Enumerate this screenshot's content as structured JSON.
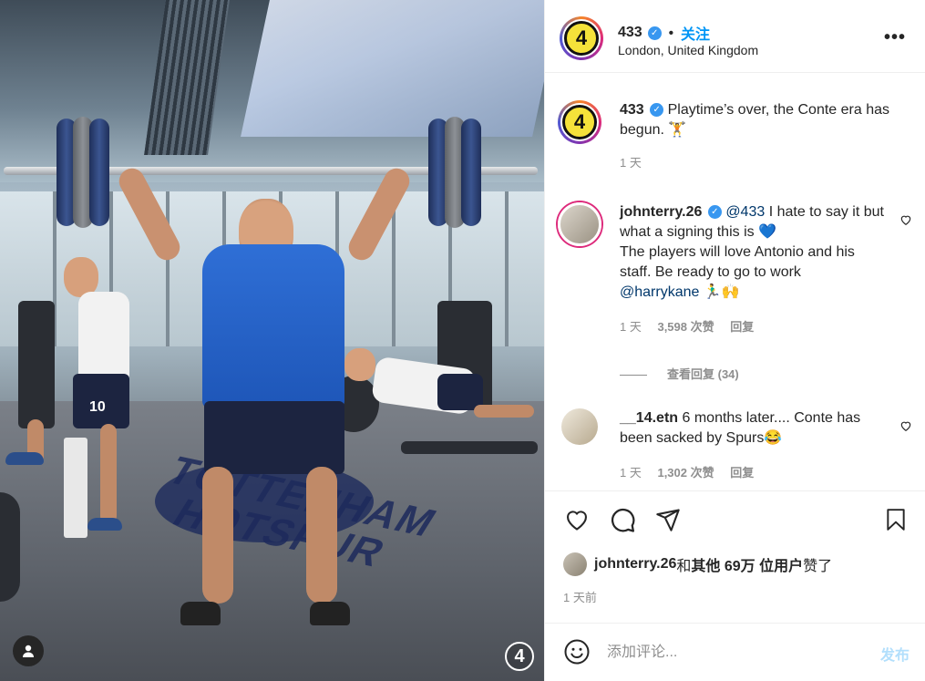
{
  "header": {
    "username": "433",
    "follow_label": "关注",
    "location": "London, United Kingdom",
    "more_icon": "more-horizontal-icon"
  },
  "caption": {
    "username": "433",
    "text": "Playtime’s over, the Conte era has begun. 🏋",
    "time": "1 天"
  },
  "comments": [
    {
      "username": "johnterry.26",
      "mention": "@433",
      "text_line1": " I hate to say it but what a signing this is 💙",
      "text_line2": "The players will love Antonio and his staff. Be ready to go to work",
      "mention2": "@harrykane",
      "emoji_tail": " 🏃‍♂️🙌",
      "time": "1 天",
      "likes": "3,598 次赞",
      "reply_label": "回复",
      "view_replies": "查看回复 (34)"
    },
    {
      "username": "__14.etn",
      "text": " 6 months later.... Conte has been sacked by Spurs😂",
      "time": "1 天",
      "likes": "1,302 次赞",
      "reply_label": "回复"
    }
  ],
  "likes": {
    "user": "johnterry.26",
    "and": " 和 ",
    "others": "其他 69万 位用户",
    "suffix": " 赞了"
  },
  "post_date": "1 天前",
  "add_comment": {
    "placeholder": "添加评论...",
    "post_label": "发布"
  },
  "media": {
    "crest_line1": "TOTTENHAM",
    "crest_line2": "HOTSPUR",
    "corner_logo": "4",
    "shorts_number": "10"
  },
  "colors": {
    "accent_blue": "#0095f6",
    "verified_blue": "#3897f0",
    "logo_yellow": "#f5e23a"
  }
}
